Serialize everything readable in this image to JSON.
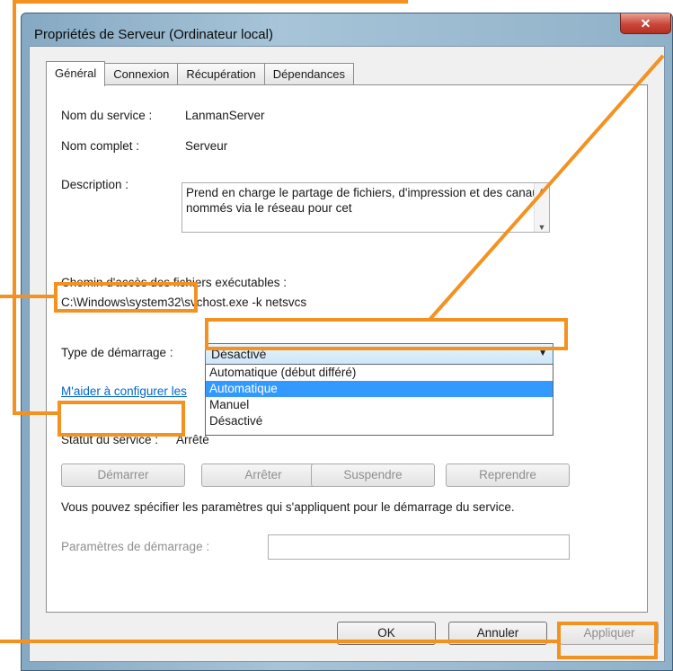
{
  "window": {
    "title": "Propriétés de Serveur (Ordinateur local)",
    "close_glyph": "✕"
  },
  "tabs": [
    {
      "label": "Général"
    },
    {
      "label": "Connexion"
    },
    {
      "label": "Récupération"
    },
    {
      "label": "Dépendances"
    }
  ],
  "general": {
    "service_name_label": "Nom du service :",
    "service_name_value": "LanmanServer",
    "display_name_label": "Nom complet :",
    "display_name_value": "Serveur",
    "description_label": "Description :",
    "description_value": "Prend en charge le partage de fichiers, d'impression et des canaux nommés via le réseau pour cet",
    "path_label": "Chemin d'accès des fichiers exécutables :",
    "path_value": "C:\\Windows\\system32\\svchost.exe -k netsvcs",
    "startup_type_label": "Type de démarrage :",
    "startup_type_value": "Désactivé",
    "startup_options": [
      "Automatique (début différé)",
      "Automatique",
      "Manuel",
      "Désactivé"
    ],
    "selected_option_index": 1,
    "help_link": "M'aider à configurer les",
    "status_label": "Statut du service :",
    "status_value": "Arrêté",
    "buttons": {
      "start": "Démarrer",
      "stop": "Arrêter",
      "pause": "Suspendre",
      "resume": "Reprendre"
    },
    "params_note": "Vous pouvez spécifier les paramètres qui s'appliquent pour le démarrage du service.",
    "params_label": "Paramètres de démarrage :"
  },
  "footer": {
    "ok": "OK",
    "cancel": "Annuler",
    "apply": "Appliquer"
  },
  "colors": {
    "highlight": "#f39221",
    "selection": "#3399ff",
    "link": "#0066cc"
  }
}
